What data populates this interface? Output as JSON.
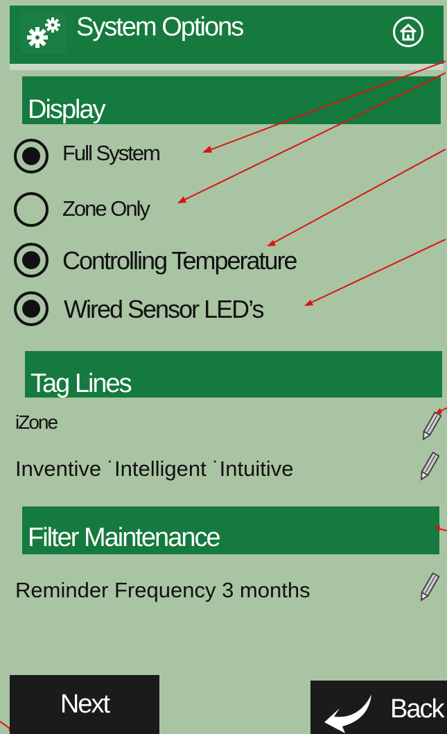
{
  "header": {
    "title": "System Options"
  },
  "icons": {
    "settings": "gear-icon",
    "home": "home-icon",
    "edit": "pencil-icon",
    "back": "return-arrow-icon"
  },
  "display": {
    "heading": "Display",
    "options": [
      {
        "label": "Full System",
        "selected": true
      },
      {
        "label": "Zone Only",
        "selected": false
      },
      {
        "label": "Controlling Temperature",
        "selected": true
      },
      {
        "label": "Wired Sensor LED’s",
        "selected": true
      }
    ]
  },
  "tag_lines": {
    "heading": "Tag Lines",
    "items": [
      {
        "text": "iZone"
      },
      {
        "text": "Inventive ˙Intelligent ˙Intuitive"
      }
    ]
  },
  "filter_maintenance": {
    "heading": "Filter Maintenance",
    "reminder_text": "Reminder Frequency 3 months"
  },
  "footer": {
    "next_label": "Next",
    "back_label": "Back"
  },
  "colors": {
    "header_green": "#167a3f",
    "background": "#a9c4a2",
    "annotation_red": "#d91313",
    "button_dark": "#1b1b1b"
  }
}
